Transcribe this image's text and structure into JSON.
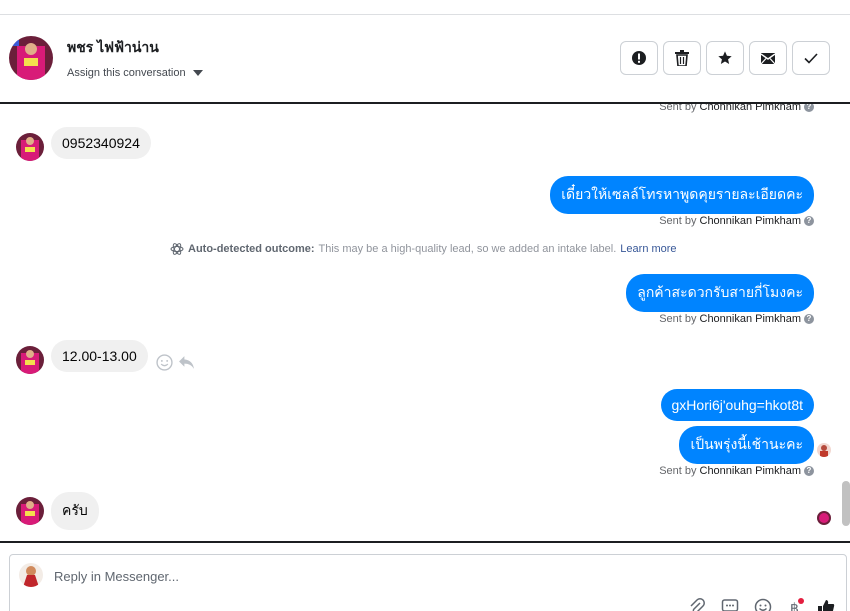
{
  "header": {
    "contact_name": "พชร ไฟฟ้าน่าน",
    "assign_label": "Assign this conversation",
    "actions": [
      {
        "name": "mark-spam-button",
        "icon": "exclamation-icon"
      },
      {
        "name": "delete-button",
        "icon": "trash-icon"
      },
      {
        "name": "star-button",
        "icon": "star-icon"
      },
      {
        "name": "mark-unread-button",
        "icon": "envelope-icon"
      },
      {
        "name": "mark-done-button",
        "icon": "check-icon"
      }
    ]
  },
  "thread": {
    "sent_by_prefix": "Sent by",
    "agent_name": "Chonnikan Pimkham",
    "messages": [
      {
        "id": "m1",
        "direction": "in",
        "text": "0952340924"
      },
      {
        "id": "m2",
        "direction": "out",
        "text": "เดี๋ยวให้เซลล์โทรหาพูดคุยรายละเอียดคะ"
      },
      {
        "id": "m3",
        "direction": "out",
        "text": "ลูกค้าสะดวกรับสายกี่โมงคะ"
      },
      {
        "id": "m4",
        "direction": "in",
        "text": "12.00-13.00"
      },
      {
        "id": "m5",
        "direction": "out",
        "text": "gxHori6j'ouhg=hkot8t"
      },
      {
        "id": "m6",
        "direction": "out",
        "text": "เป็นพรุ่งนี้เช้านะคะ"
      },
      {
        "id": "m7",
        "direction": "in",
        "text": "ครับ"
      }
    ],
    "outcome": {
      "label": "Auto-detected outcome:",
      "text": "This may be a high-quality lead, so we added an intake label.",
      "link": "Learn more"
    }
  },
  "composer": {
    "placeholder": "Reply in Messenger..."
  },
  "colors": {
    "outgoing_bubble": "#0084ff",
    "incoming_bubble": "#f0f0f0",
    "link": "#385898"
  }
}
